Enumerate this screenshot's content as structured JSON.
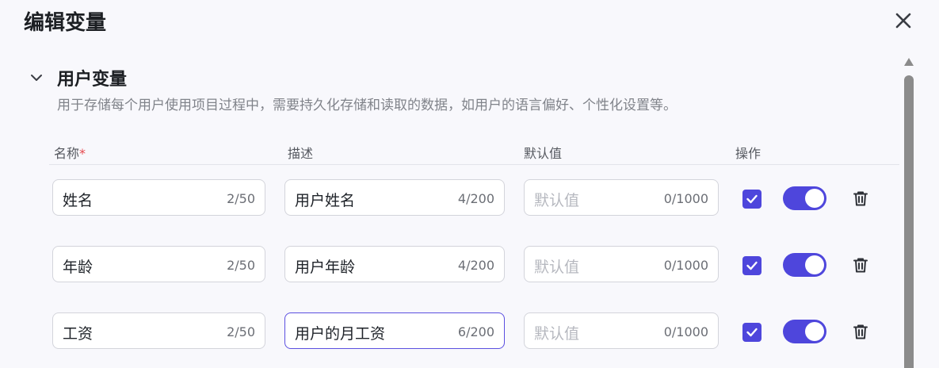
{
  "dialog": {
    "title": "编辑变量"
  },
  "section": {
    "title": "用户变量",
    "description": "用于存储每个用户使用项目过程中，需要持久化存储和读取的数据，如用户的语言偏好、个性化设置等。"
  },
  "columns": {
    "name": "名称",
    "required_mark": "*",
    "description": "描述",
    "default": "默认值",
    "actions": "操作"
  },
  "rows": [
    {
      "name": "姓名",
      "name_count": "2/50",
      "desc": "用户姓名",
      "desc_count": "4/200",
      "default_placeholder": "默认值",
      "default_count": "0/1000",
      "checked": true,
      "enabled": true
    },
    {
      "name": "年龄",
      "name_count": "2/50",
      "desc": "用户年龄",
      "desc_count": "4/200",
      "default_placeholder": "默认值",
      "default_count": "0/1000",
      "checked": true,
      "enabled": true
    },
    {
      "name": "工资",
      "name_count": "2/50",
      "desc": "用户的月工资",
      "desc_count": "6/200",
      "default_placeholder": "默认值",
      "default_count": "0/1000",
      "checked": true,
      "enabled": true
    }
  ],
  "icons": {
    "close": "close-icon",
    "collapse": "chevron-down-icon",
    "check": "check-icon",
    "delete": "trash-icon",
    "scroll": "scroll-up-arrow"
  },
  "colors": {
    "accent": "#4e46dc",
    "required": "#e5484d",
    "focus_border": "#5b4fe0"
  }
}
